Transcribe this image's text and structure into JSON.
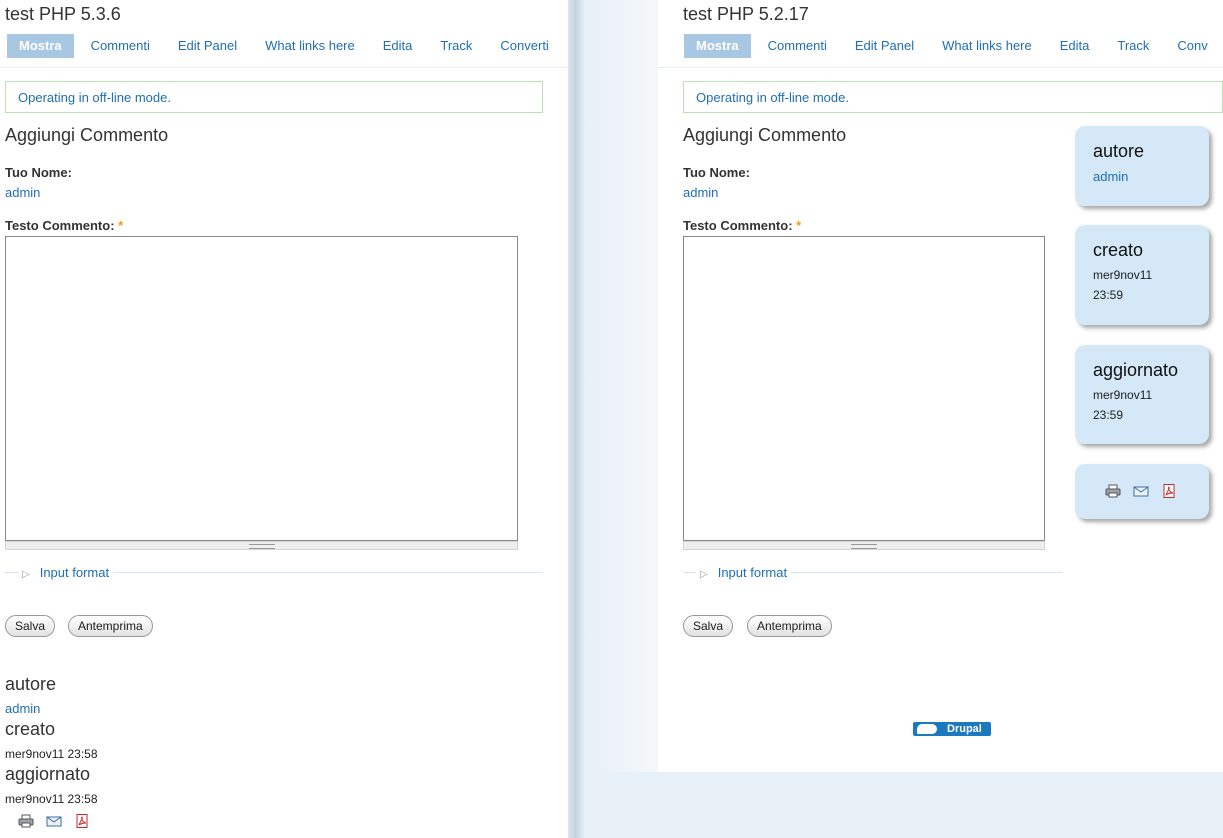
{
  "left": {
    "site_title": "test PHP 5.3.6",
    "tabs": [
      "Mostra",
      "Commenti",
      "Edit Panel",
      "What links here",
      "Edita",
      "Track",
      "Converti"
    ],
    "status": "Operating in off-line mode.",
    "heading": "Aggiungi Commento",
    "name_label": "Tuo Nome:",
    "name_value": "admin",
    "comment_label": "Testo Commento:",
    "required_mark": "*",
    "input_format": "Input format",
    "save_label": "Salva",
    "preview_label": "Antemprima",
    "info": {
      "author_title": "autore",
      "author_value": "admin",
      "created_title": "creato",
      "created_value": "mer9nov11 23:58",
      "updated_title": "aggiornato",
      "updated_value": "mer9nov11 23:58"
    }
  },
  "right": {
    "site_title": "test PHP 5.2.17",
    "tabs": [
      "Mostra",
      "Commenti",
      "Edit Panel",
      "What links here",
      "Edita",
      "Track",
      "Conv"
    ],
    "status": "Operating in off-line mode.",
    "heading": "Aggiungi Commento",
    "name_label": "Tuo Nome:",
    "name_value": "admin",
    "comment_label": "Testo Commento:",
    "required_mark": "*",
    "input_format": "Input format",
    "save_label": "Salva",
    "preview_label": "Antemprima",
    "cards": {
      "author_title": "autore",
      "author_value": "admin",
      "created_title": "creato",
      "created_line1": "mer9nov11",
      "created_line2": "23:59",
      "updated_title": "aggiornato",
      "updated_line1": "mer9nov11",
      "updated_line2": "23:59"
    },
    "badge": "Drupal"
  },
  "icons": [
    "printer-icon",
    "email-icon",
    "pdf-icon"
  ],
  "colors": {
    "link": "#1f6fb2",
    "tab_active": "#a8c7e2",
    "card": "#d4e8f7",
    "status_border": "#bce2b3"
  }
}
